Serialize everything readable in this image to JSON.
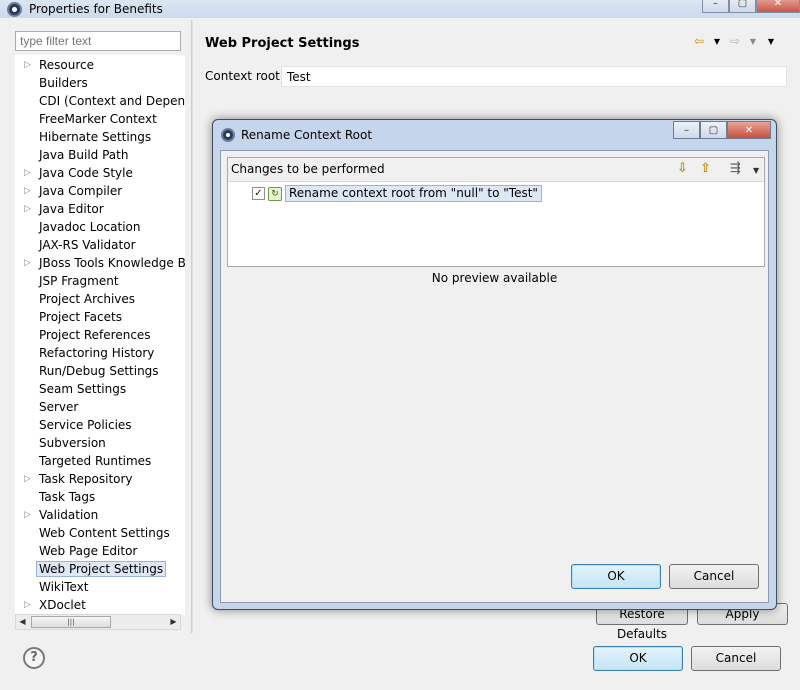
{
  "window": {
    "title": "Properties for Benefits",
    "minimize": "–",
    "maximize": "▢",
    "close": "✕"
  },
  "filter": {
    "placeholder": "type filter text"
  },
  "tree": {
    "items": [
      {
        "label": "Resource",
        "expandable": true
      },
      {
        "label": "Builders",
        "expandable": false
      },
      {
        "label": "CDI (Context and Dependency Injection)",
        "expandable": false
      },
      {
        "label": "FreeMarker Context",
        "expandable": false
      },
      {
        "label": "Hibernate Settings",
        "expandable": false
      },
      {
        "label": "Java Build Path",
        "expandable": false
      },
      {
        "label": "Java Code Style",
        "expandable": true
      },
      {
        "label": "Java Compiler",
        "expandable": true
      },
      {
        "label": "Java Editor",
        "expandable": true
      },
      {
        "label": "Javadoc Location",
        "expandable": false
      },
      {
        "label": "JAX-RS Validator",
        "expandable": false
      },
      {
        "label": "JBoss Tools Knowledge Base",
        "expandable": true
      },
      {
        "label": "JSP Fragment",
        "expandable": false
      },
      {
        "label": "Project Archives",
        "expandable": false
      },
      {
        "label": "Project Facets",
        "expandable": false
      },
      {
        "label": "Project References",
        "expandable": false
      },
      {
        "label": "Refactoring History",
        "expandable": false
      },
      {
        "label": "Run/Debug Settings",
        "expandable": false
      },
      {
        "label": "Seam Settings",
        "expandable": false
      },
      {
        "label": "Server",
        "expandable": false
      },
      {
        "label": "Service Policies",
        "expandable": false
      },
      {
        "label": "Subversion",
        "expandable": false
      },
      {
        "label": "Targeted Runtimes",
        "expandable": false
      },
      {
        "label": "Task Repository",
        "expandable": true
      },
      {
        "label": "Task Tags",
        "expandable": false
      },
      {
        "label": "Validation",
        "expandable": true
      },
      {
        "label": "Web Content Settings",
        "expandable": false
      },
      {
        "label": "Web Page Editor",
        "expandable": false
      },
      {
        "label": "Web Project Settings",
        "expandable": false,
        "selected": true
      },
      {
        "label": "WikiText",
        "expandable": false
      },
      {
        "label": "XDoclet",
        "expandable": true
      }
    ]
  },
  "page": {
    "title": "Web Project Settings",
    "context_root_label": "Context root:",
    "context_root_value": "Test",
    "restore_defaults": "Restore Defaults",
    "apply": "Apply"
  },
  "footer": {
    "help": "?",
    "ok": "OK",
    "cancel": "Cancel"
  },
  "dialog": {
    "title": "Rename Context Root",
    "changes_label": "Changes to be performed",
    "change_text": "Rename context root from \"null\" to \"Test\"",
    "change_checked": true,
    "no_preview": "No preview available",
    "ok": "OK",
    "cancel": "Cancel"
  }
}
